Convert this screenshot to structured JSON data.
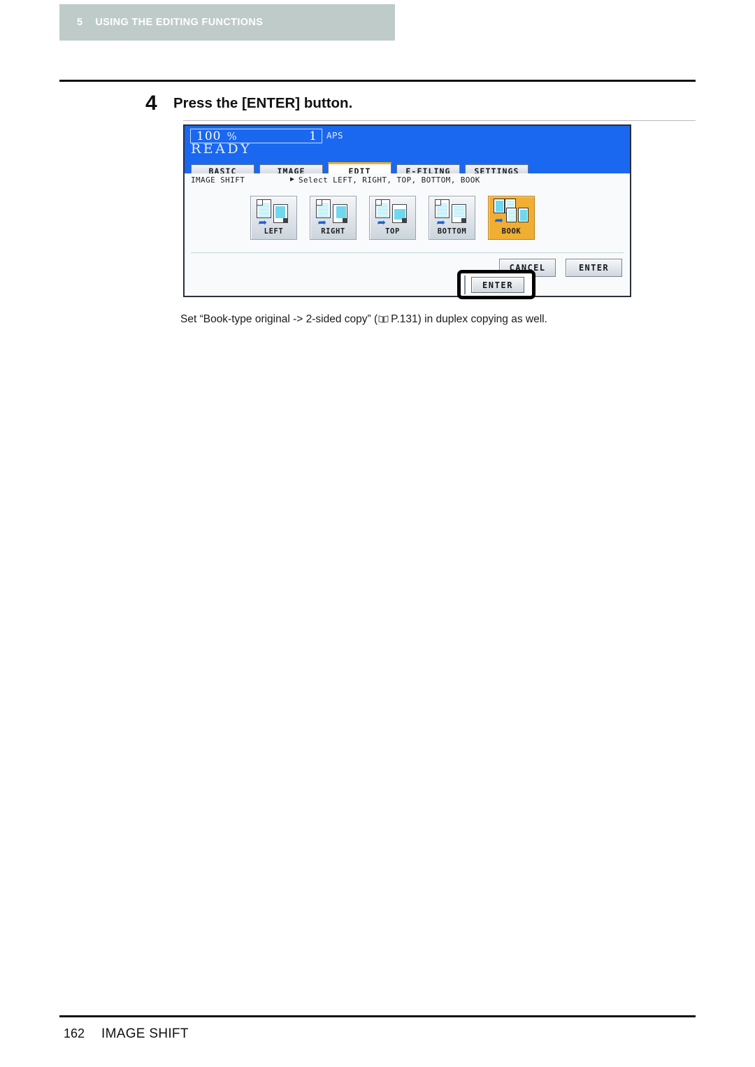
{
  "running_head": {
    "chapter_number": "5",
    "chapter_title": "USING THE EDITING FUNCTIONS",
    "band_color": "#bfcbc9"
  },
  "step": {
    "number": "4",
    "instruction": "Press the [ENTER] button."
  },
  "lcd": {
    "status_bar": {
      "zoom": "100",
      "percent_sign": "%",
      "copies": "1",
      "paper_mode": "APS",
      "status_text": "READY",
      "background_color": "#1a68f0"
    },
    "tabs": [
      {
        "label": "BASIC",
        "active": false
      },
      {
        "label": "IMAGE",
        "active": false
      },
      {
        "label": "EDIT",
        "active": true
      },
      {
        "label": "E-FILING",
        "active": false
      },
      {
        "label": "SETTINGS",
        "active": false
      }
    ],
    "active_tab_accent": "#f0b323",
    "subheader": {
      "function_name": "IMAGE SHIFT",
      "arrow": "▶",
      "prompt": "Select LEFT, RIGHT, TOP, BOTTOM, BOOK"
    },
    "shift_buttons": [
      {
        "label": "LEFT",
        "icon": "page-shift-left-icon",
        "selected": false
      },
      {
        "label": "RIGHT",
        "icon": "page-shift-right-icon",
        "selected": false
      },
      {
        "label": "TOP",
        "icon": "page-shift-top-icon",
        "selected": false
      },
      {
        "label": "BOTTOM",
        "icon": "page-shift-bottom-icon",
        "selected": false
      },
      {
        "label": "BOOK",
        "icon": "book-shift-icon",
        "selected": true
      }
    ],
    "selected_color": "#f0ae32",
    "actions": {
      "cancel_label": "CANCEL",
      "enter_label": "ENTER"
    }
  },
  "callout": {
    "highlighted_button": "ENTER",
    "border_color": "#000000"
  },
  "caption": {
    "before_icon": "Set “Book-type original -> 2-sided copy” (",
    "icon": "book-reference-icon",
    "after_icon": "P.131) in duplex copying as well."
  },
  "footer": {
    "page_number": "162",
    "section_title": "IMAGE SHIFT"
  }
}
